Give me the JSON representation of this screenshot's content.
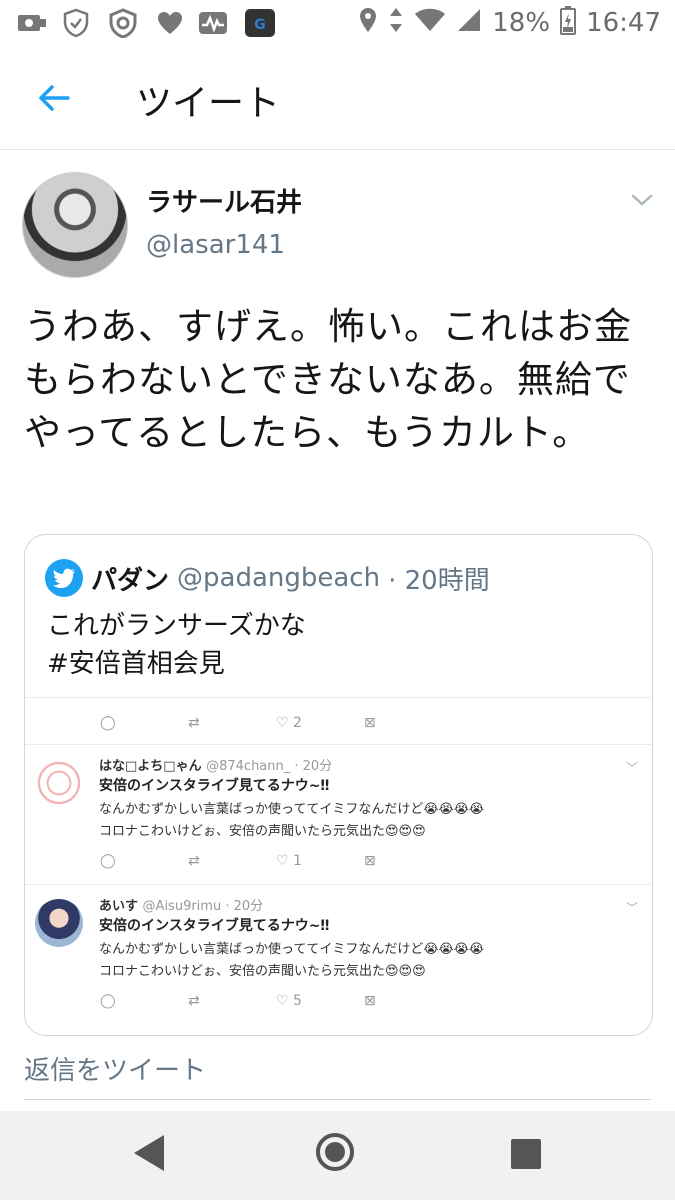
{
  "status_bar": {
    "battery_text": "18%",
    "time": "16:47"
  },
  "app_bar": {
    "title": "ツイート"
  },
  "tweet": {
    "author_name": "ラサール石井",
    "author_handle": "@lasar141",
    "text": "うわあ、すげえ。怖い。これはお金もらわないとできないなあ。無給でやってるとしたら、もうカルト。"
  },
  "quoted_tweet": {
    "author_name": "パダン",
    "author_handle": "@padangbeach",
    "time": "· 20時間",
    "text_line1": "これがランサーズかな",
    "text_line2": "#安倍首相会見"
  },
  "embedded_image": {
    "top_actions": {
      "like_count": "2"
    },
    "tweets": [
      {
        "name": "はな□よち□ゃん",
        "handle": "@874chann_ · 20分",
        "line1": "安倍のインスタライブ見てるナウ~‼",
        "line2": "なんかむずかしい言葉ばっか使っててイミフなんだけど😭😭😭😭",
        "line3": "コロナこわいけどぉ、安倍の声聞いたら元気出た😍😍😍",
        "like_count": "1"
      },
      {
        "name": "あいす",
        "handle": "@Aisu9rimu · 20分",
        "line1": "安倍のインスタライブ見てるナウ~‼",
        "line2": "なんかむずかしい言葉ばっか使っててイミフなんだけど😭😭😭😭",
        "line3": "コロナこわいけどぉ、安倍の声聞いたら元気出た😍😍😍",
        "like_count": "5"
      }
    ]
  },
  "reply": {
    "placeholder": "返信をツイート"
  },
  "colors": {
    "accent": "#1da1f2",
    "secondary_text": "#657786",
    "divider": "#e1e8ed"
  }
}
